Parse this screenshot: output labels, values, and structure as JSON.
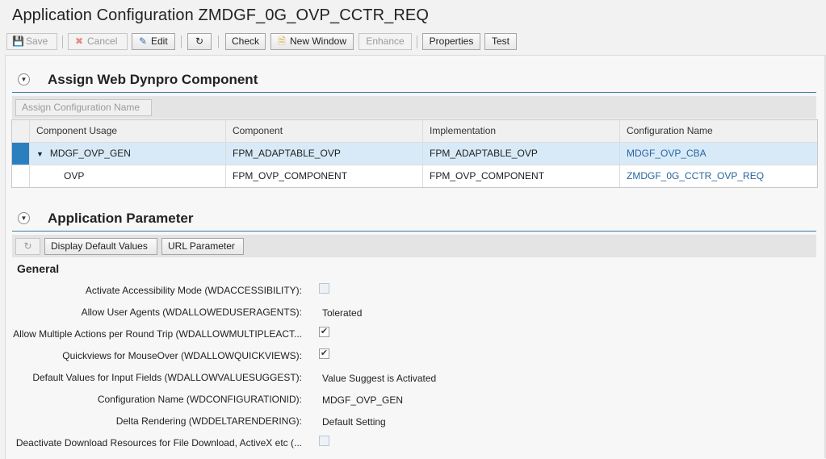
{
  "app_title": "Application Configuration ZMDGF_0G_OVP_CCTR_REQ",
  "toolbar": {
    "save": "Save",
    "cancel": "Cancel",
    "edit": "Edit",
    "check": "Check",
    "new_window": "New Window",
    "enhance": "Enhance",
    "properties": "Properties",
    "test": "Test"
  },
  "assign_panel": {
    "title": "Assign Web Dynpro Component",
    "assign_button": "Assign Configuration Name",
    "columns": [
      "Component Usage",
      "Component",
      "Implementation",
      "Configuration Name"
    ],
    "rows": [
      {
        "usage": "MDGF_OVP_GEN",
        "component": "FPM_ADAPTABLE_OVP",
        "implementation": "FPM_ADAPTABLE_OVP",
        "config": "MDGF_OVP_CBA"
      },
      {
        "usage": "OVP",
        "component": "FPM_OVP_COMPONENT",
        "implementation": "FPM_OVP_COMPONENT",
        "config": "ZMDGF_0G_CCTR_OVP_REQ"
      }
    ]
  },
  "param_panel": {
    "title": "Application Parameter",
    "display_defaults": "Display Default Values",
    "url_parameter": "URL Parameter",
    "section": "General",
    "fields": [
      {
        "label": "Activate Accessibility Mode (WDACCESSIBILITY):",
        "kind": "checkbox",
        "checked": false,
        "disabled": true
      },
      {
        "label": "Allow User Agents (WDALLOWEDUSERAGENTS):",
        "kind": "text",
        "value": "Tolerated"
      },
      {
        "label": "Allow Multiple Actions per Round Trip (WDALLOWMULTIPLEACT...",
        "kind": "checkbox",
        "checked": true
      },
      {
        "label": "Quickviews for MouseOver (WDALLOWQUICKVIEWS):",
        "kind": "checkbox",
        "checked": true
      },
      {
        "label": "Default Values for Input Fields (WDALLOWVALUESUGGEST):",
        "kind": "text",
        "value": "Value Suggest is Activated"
      },
      {
        "label": "Configuration Name (WDCONFIGURATIONID):",
        "kind": "text",
        "value": "MDGF_OVP_GEN"
      },
      {
        "label": "Delta Rendering (WDDELTARENDERING):",
        "kind": "text",
        "value": "Default Setting"
      },
      {
        "label": "Deactivate Download Resources for File Download, ActiveX etc (...",
        "kind": "checkbox",
        "checked": false,
        "disabled": true
      }
    ]
  }
}
